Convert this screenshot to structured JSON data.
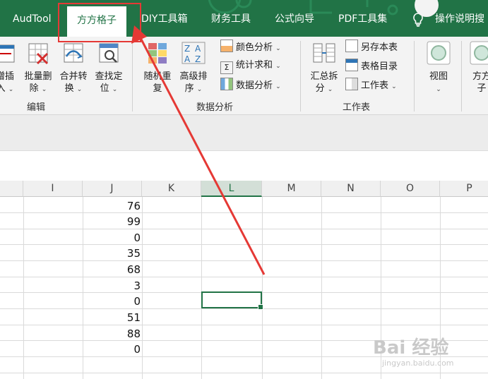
{
  "tabs": [
    {
      "label": "AudTool"
    },
    {
      "label": "方方格子"
    },
    {
      "label": "DIY工具箱"
    },
    {
      "label": "财务工具"
    },
    {
      "label": "公式向导"
    },
    {
      "label": "PDF工具集"
    },
    {
      "label": "操作说明搜"
    }
  ],
  "active_tab": "方方格子",
  "ribbon": {
    "edit_group": {
      "label": "编辑",
      "btn_insert": {
        "line1": "增插",
        "line2": "入"
      },
      "btn_batch_delete": {
        "line1": "批量删",
        "line2": "除"
      },
      "btn_merge": {
        "line1": "合并转",
        "line2": "换"
      },
      "btn_find": {
        "line1": "查找定",
        "line2": "位"
      }
    },
    "data_group": {
      "label": "数据分析",
      "btn_dup": {
        "line1": "随机重",
        "line2": "复"
      },
      "btn_sort": {
        "line1": "高级排",
        "line2": "序"
      },
      "color_analysis": "颜色分析",
      "stat_sum": "统计求和",
      "data_analysis": "数据分析"
    },
    "sheet_group": {
      "label": "工作表",
      "btn_summary": {
        "line1": "汇总拆",
        "line2": "分"
      },
      "save_as": "另存本表",
      "sheet_index": "表格目录",
      "worksheet": "工作表"
    },
    "view": {
      "label": "视图"
    },
    "fangfang": {
      "line1": "方方",
      "line2": "子"
    }
  },
  "columns": [
    "I",
    "J",
    "K",
    "L",
    "M",
    "N",
    "O",
    "P"
  ],
  "selected_column": "L",
  "column_j_values": [
    "76",
    "99",
    "0",
    "35",
    "68",
    "3",
    "0",
    "51",
    "88",
    "0"
  ],
  "watermark": {
    "text": "Bai 经验",
    "url": "jingyan.baidu.com"
  },
  "colors": {
    "accent": "#217346",
    "annotation": "#e53935"
  }
}
